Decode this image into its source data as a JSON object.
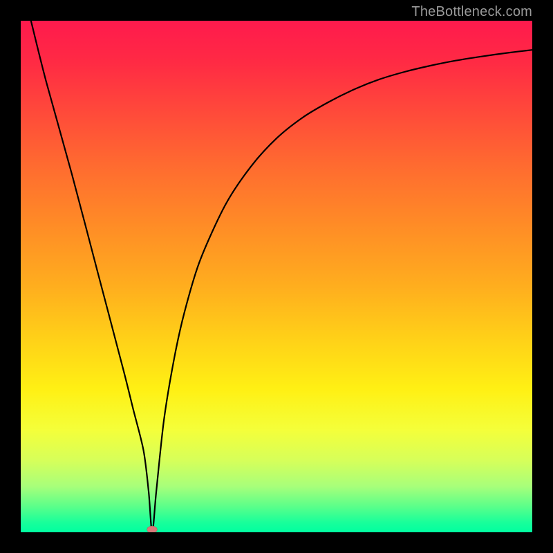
{
  "watermark": "TheBottleneck.com",
  "chart_data": {
    "type": "line",
    "title": "",
    "xlabel": "",
    "ylabel": "",
    "xlim": [
      0,
      100
    ],
    "ylim": [
      0,
      100
    ],
    "series": [
      {
        "name": "curve",
        "x": [
          2,
          5,
          10,
          15,
          20,
          22,
          24,
          25,
          25.7,
          26.5,
          28,
          30,
          32,
          35,
          40,
          45,
          50,
          55,
          60,
          65,
          70,
          75,
          80,
          85,
          90,
          95,
          100
        ],
        "values": [
          100,
          88,
          70,
          51,
          32,
          24,
          16,
          8,
          0,
          8,
          22,
          34,
          43,
          53,
          64,
          71.5,
          77,
          81,
          84,
          86.5,
          88.5,
          90,
          91.2,
          92.2,
          93,
          93.7,
          94.3
        ]
      }
    ],
    "marker": {
      "x": 25.7,
      "y": 0
    },
    "background_gradient": {
      "top": "#ff1a4d",
      "bottom": "#00ffa0"
    }
  }
}
